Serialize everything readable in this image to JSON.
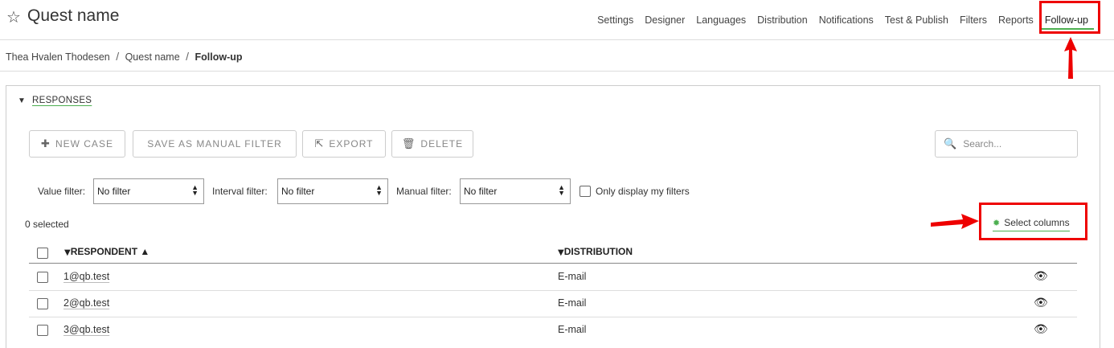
{
  "header": {
    "title": "Quest name",
    "star_icon": "star-outline-icon",
    "nav": [
      {
        "label": "Settings"
      },
      {
        "label": "Designer"
      },
      {
        "label": "Languages"
      },
      {
        "label": "Distribution"
      },
      {
        "label": "Notifications"
      },
      {
        "label": "Test & Publish"
      },
      {
        "label": "Filters"
      },
      {
        "label": "Reports"
      },
      {
        "label": "Follow-up",
        "active": true
      }
    ]
  },
  "breadcrumb": {
    "items": [
      "Thea Hvalen Thodesen",
      "Quest name"
    ],
    "current": "Follow-up",
    "separator": "/"
  },
  "responses": {
    "section_title": "RESPONSES",
    "buttons": {
      "new_case": "NEW CASE",
      "save_manual_filter": "SAVE AS MANUAL FILTER",
      "export": "EXPORT",
      "delete": "DELETE"
    },
    "search": {
      "placeholder": "Search..."
    },
    "filters": {
      "value_label": "Value filter:",
      "value_selected": "No filter",
      "interval_label": "Interval filter:",
      "interval_selected": "No filter",
      "manual_label": "Manual filter:",
      "manual_selected": "No filter",
      "only_mine_label": "Only display my filters"
    },
    "selected_count": "0 selected",
    "select_columns": "Select columns",
    "columns": {
      "respondent": "RESPONDENT",
      "respondent_sort": "▲",
      "distribution": "DISTRIBUTION"
    },
    "rows": [
      {
        "respondent": "1@qb.test",
        "distribution": "E-mail"
      },
      {
        "respondent": "2@qb.test",
        "distribution": "E-mail"
      },
      {
        "respondent": "3@qb.test",
        "distribution": "E-mail"
      }
    ]
  },
  "colors": {
    "accent": "#4caf50",
    "annotation": "#e00000"
  }
}
